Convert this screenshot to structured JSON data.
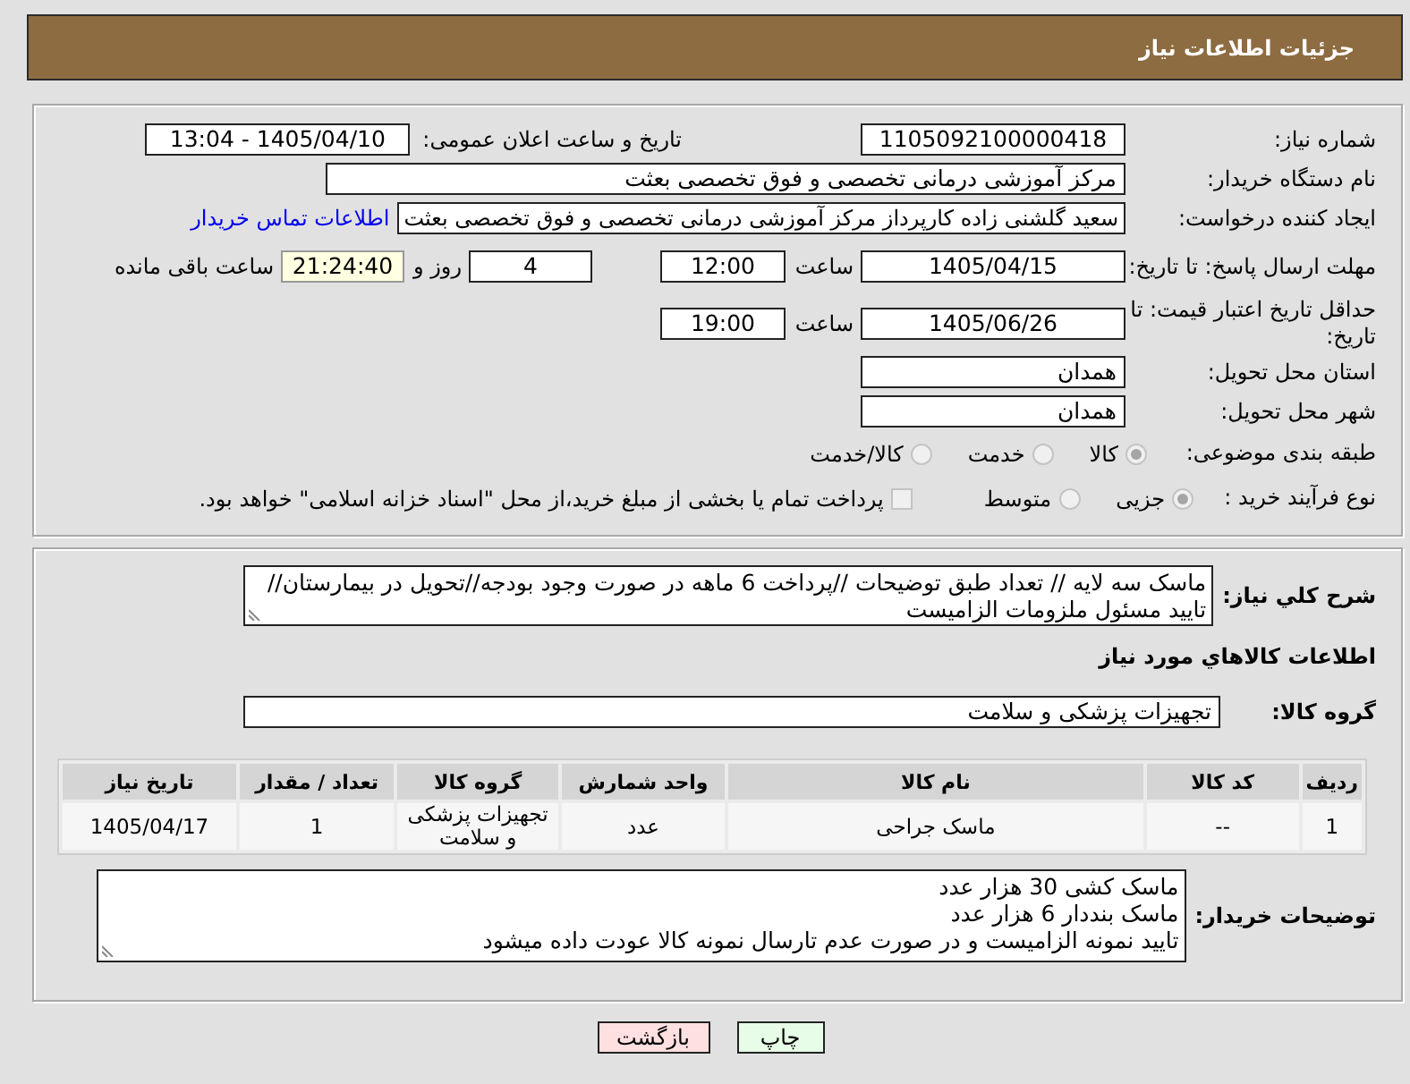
{
  "header": {
    "title": "جزئیات اطلاعات نیاز"
  },
  "details": {
    "need_number": {
      "label": "شماره نیاز:",
      "value": "1105092100000418"
    },
    "announce": {
      "label": "تاریخ و ساعت اعلان عمومی:",
      "value": "1405/04/10 - 13:04"
    },
    "buyer_org": {
      "label": "نام دستگاه خریدار:",
      "value": "مرکز آموزشی درمانی تخصصی و فوق تخصصی بعثت"
    },
    "requester": {
      "label": "ایجاد کننده درخواست:",
      "value": "سعید گلشنی زاده کارپرداز مرکز آموزشی درمانی تخصصی و فوق تخصصی بعثت",
      "link": "اطلاعات تماس خریدار"
    },
    "response_deadline": {
      "label": "مهلت ارسال پاسخ: تا تاریخ:",
      "date": "1405/04/15",
      "time_label": "ساعت",
      "time": "12:00",
      "days": "4",
      "days_label": "روز و",
      "remaining": "21:24:40",
      "remaining_label": "ساعت باقی مانده"
    },
    "price_validity": {
      "label": "حداقل تاریخ اعتبار قیمت: تا تاریخ:",
      "date": "1405/06/26",
      "time_label": "ساعت",
      "time": "19:00"
    },
    "province": {
      "label": "استان محل تحویل:",
      "value": "همدان"
    },
    "city": {
      "label": "شهر محل تحویل:",
      "value": "همدان"
    },
    "category": {
      "label": "طبقه بندی موضوعی:",
      "disabled": true,
      "options": [
        {
          "label": "کالا",
          "selected": true
        },
        {
          "label": "خدمت",
          "selected": false
        },
        {
          "label": "کالا/خدمت",
          "selected": false
        }
      ]
    },
    "process": {
      "label": "نوع فرآیند خرید :",
      "disabled": true,
      "options": [
        {
          "label": "جزیی",
          "selected": true
        },
        {
          "label": "متوسط",
          "selected": false
        }
      ],
      "treasury_checkbox": {
        "label": "پرداخت تمام یا بخشی از مبلغ خرید،از محل \"اسناد خزانه اسلامی\" خواهد بود.",
        "checked": false,
        "disabled": true
      }
    }
  },
  "needs": {
    "description_label": "شرح کلي نیاز:",
    "description": "ماسک سه لایه // تعداد طبق توضیحات //پرداخت 6 ماهه در صورت وجود بودجه//تحویل در بیمارستان//تایید مسئول ملزومات الزامیست",
    "items_heading": "اطلاعات کالاهاي مورد نیاز",
    "group_label": "گروه کالا:",
    "group": "تجهیزات پزشکی و سلامت",
    "table": {
      "columns": [
        "ردیف",
        "کد کالا",
        "نام کالا",
        "واحد شمارش",
        "گروه کالا",
        "تعداد / مقدار",
        "تاریخ نیاز"
      ],
      "rows": [
        [
          "1",
          "--",
          "ماسک جراحی",
          "عدد",
          "تجهیزات پزشکی و سلامت",
          "1",
          "1405/04/17"
        ]
      ]
    },
    "buyer_notes_label": "توضیحات خریدار:",
    "buyer_notes": "ماسک کشی 30 هزار عدد\nماسک بنددار 6 هزار عدد\nتایید نمونه الزامیست و در صورت عدم تارسال نمونه کالا عودت داده میشود"
  },
  "buttons": [
    {
      "label": "چاپ",
      "kind": "print"
    },
    {
      "label": "بازگشت",
      "kind": "back"
    }
  ]
}
